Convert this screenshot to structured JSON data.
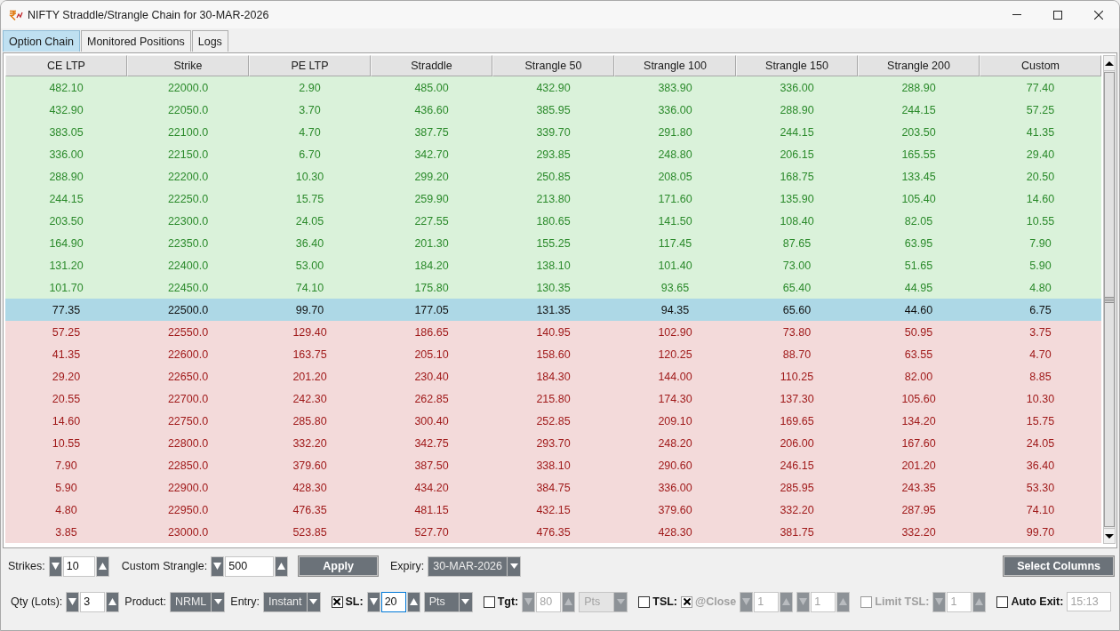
{
  "window": {
    "title": "NIFTY Straddle/Strangle Chain for 30-MAR-2026"
  },
  "tabs": [
    {
      "label": "Option Chain",
      "selected": true
    },
    {
      "label": "Monitored Positions",
      "selected": false
    },
    {
      "label": "Logs",
      "selected": false
    }
  ],
  "table": {
    "columns": [
      "CE LTP",
      "Strike",
      "PE LTP",
      "Straddle",
      "Strangle 50",
      "Strangle 100",
      "Strangle 150",
      "Strangle 200",
      "Custom"
    ],
    "rows": [
      {
        "kind": "below_atm",
        "cells": [
          "482.10",
          "22000.0",
          "2.90",
          "485.00",
          "432.90",
          "383.90",
          "336.00",
          "288.90",
          "77.40"
        ]
      },
      {
        "kind": "below_atm",
        "cells": [
          "432.90",
          "22050.0",
          "3.70",
          "436.60",
          "385.95",
          "336.00",
          "288.90",
          "244.15",
          "57.25"
        ]
      },
      {
        "kind": "below_atm",
        "cells": [
          "383.05",
          "22100.0",
          "4.70",
          "387.75",
          "339.70",
          "291.80",
          "244.15",
          "203.50",
          "41.35"
        ]
      },
      {
        "kind": "below_atm",
        "cells": [
          "336.00",
          "22150.0",
          "6.70",
          "342.70",
          "293.85",
          "248.80",
          "206.15",
          "165.55",
          "29.40"
        ]
      },
      {
        "kind": "below_atm",
        "cells": [
          "288.90",
          "22200.0",
          "10.30",
          "299.20",
          "250.85",
          "208.05",
          "168.75",
          "133.45",
          "20.50"
        ]
      },
      {
        "kind": "below_atm",
        "cells": [
          "244.15",
          "22250.0",
          "15.75",
          "259.90",
          "213.80",
          "171.60",
          "135.90",
          "105.40",
          "14.60"
        ]
      },
      {
        "kind": "below_atm",
        "cells": [
          "203.50",
          "22300.0",
          "24.05",
          "227.55",
          "180.65",
          "141.50",
          "108.40",
          "82.05",
          "10.55"
        ]
      },
      {
        "kind": "below_atm",
        "cells": [
          "164.90",
          "22350.0",
          "36.40",
          "201.30",
          "155.25",
          "117.45",
          "87.65",
          "63.95",
          "7.90"
        ]
      },
      {
        "kind": "below_atm",
        "cells": [
          "131.20",
          "22400.0",
          "53.00",
          "184.20",
          "138.10",
          "101.40",
          "73.00",
          "51.65",
          "5.90"
        ]
      },
      {
        "kind": "below_atm",
        "cells": [
          "101.70",
          "22450.0",
          "74.10",
          "175.80",
          "130.35",
          "93.65",
          "65.40",
          "44.95",
          "4.80"
        ]
      },
      {
        "kind": "atm",
        "cells": [
          "77.35",
          "22500.0",
          "99.70",
          "177.05",
          "131.35",
          "94.35",
          "65.60",
          "44.60",
          "6.75"
        ]
      },
      {
        "kind": "above_atm",
        "cells": [
          "57.25",
          "22550.0",
          "129.40",
          "186.65",
          "140.95",
          "102.90",
          "73.80",
          "50.95",
          "3.75"
        ]
      },
      {
        "kind": "above_atm",
        "cells": [
          "41.35",
          "22600.0",
          "163.75",
          "205.10",
          "158.60",
          "120.25",
          "88.70",
          "63.55",
          "4.70"
        ]
      },
      {
        "kind": "above_atm",
        "cells": [
          "29.20",
          "22650.0",
          "201.20",
          "230.40",
          "184.30",
          "144.00",
          "110.25",
          "82.00",
          "8.85"
        ]
      },
      {
        "kind": "above_atm",
        "cells": [
          "20.55",
          "22700.0",
          "242.30",
          "262.85",
          "215.80",
          "174.30",
          "137.30",
          "105.60",
          "10.30"
        ]
      },
      {
        "kind": "above_atm",
        "cells": [
          "14.60",
          "22750.0",
          "285.80",
          "300.40",
          "252.85",
          "209.10",
          "169.65",
          "134.20",
          "15.75"
        ]
      },
      {
        "kind": "above_atm",
        "cells": [
          "10.55",
          "22800.0",
          "332.20",
          "342.75",
          "293.70",
          "248.20",
          "206.00",
          "167.60",
          "24.05"
        ]
      },
      {
        "kind": "above_atm",
        "cells": [
          "7.90",
          "22850.0",
          "379.60",
          "387.50",
          "338.10",
          "290.60",
          "246.15",
          "201.20",
          "36.40"
        ]
      },
      {
        "kind": "above_atm",
        "cells": [
          "5.90",
          "22900.0",
          "428.30",
          "434.20",
          "384.75",
          "336.00",
          "285.95",
          "243.35",
          "53.30"
        ]
      },
      {
        "kind": "above_atm",
        "cells": [
          "4.80",
          "22950.0",
          "476.35",
          "481.15",
          "432.15",
          "379.60",
          "332.20",
          "287.95",
          "74.10"
        ]
      },
      {
        "kind": "above_atm",
        "cells": [
          "3.85",
          "23000.0",
          "523.85",
          "527.70",
          "476.35",
          "428.30",
          "381.75",
          "332.20",
          "99.70"
        ]
      }
    ]
  },
  "controls": [
    {
      "items": [
        {
          "kind": "label",
          "text": "Strikes:"
        },
        {
          "kind": "spinbox",
          "value": "10",
          "disabled": false,
          "focused": false
        },
        {
          "kind": "label",
          "text": "Custom Strangle:"
        },
        {
          "kind": "spinbox",
          "value": "500",
          "disabled": false,
          "focused": false
        },
        {
          "kind": "button",
          "label": "Apply"
        },
        {
          "kind": "label",
          "text": "Expiry:"
        },
        {
          "kind": "dropdown",
          "value": "30-MAR-2026",
          "disabled": false
        },
        {
          "kind": "button",
          "label": "Select Columns"
        }
      ]
    },
    {
      "items": [
        {
          "kind": "label",
          "text": "Qty (Lots):"
        },
        {
          "kind": "spinbox",
          "value": "3",
          "disabled": false,
          "focused": false
        },
        {
          "kind": "label",
          "text": "Product:"
        },
        {
          "kind": "dropdown",
          "value": "NRML",
          "disabled": false
        },
        {
          "kind": "label",
          "text": "Entry:"
        },
        {
          "kind": "dropdown",
          "value": "Instant",
          "disabled": false
        },
        {
          "kind": "checkbox",
          "label": "SL:",
          "checked": true,
          "disabled": false
        },
        {
          "kind": "spinbox",
          "value": "20",
          "disabled": false,
          "focused": true
        },
        {
          "kind": "dropdown",
          "value": "Pts",
          "disabled": false
        },
        {
          "kind": "checkbox",
          "label": "Tgt:",
          "checked": false,
          "disabled": false
        },
        {
          "kind": "spinbox",
          "value": "80",
          "disabled": true,
          "focused": false
        },
        {
          "kind": "dropdown",
          "value": "Pts",
          "disabled": true
        },
        {
          "kind": "checkbox",
          "label": "TSL:",
          "checked": false,
          "disabled": false
        },
        {
          "kind": "checkbox",
          "label": "@Close",
          "checked": true,
          "disabled": true
        },
        {
          "kind": "spinbox",
          "value": "1",
          "disabled": true,
          "focused": false
        },
        {
          "kind": "spinbox",
          "value": "1",
          "disabled": true,
          "focused": false
        },
        {
          "kind": "checkbox",
          "label": "Limit TSL:",
          "checked": false,
          "disabled": true
        },
        {
          "kind": "spinbox",
          "value": "1",
          "disabled": true,
          "focused": false
        },
        {
          "kind": "checkbox",
          "label": "Auto Exit:",
          "checked": false,
          "disabled": false
        },
        {
          "kind": "entry",
          "value": "15:13",
          "disabled": true
        }
      ]
    }
  ]
}
